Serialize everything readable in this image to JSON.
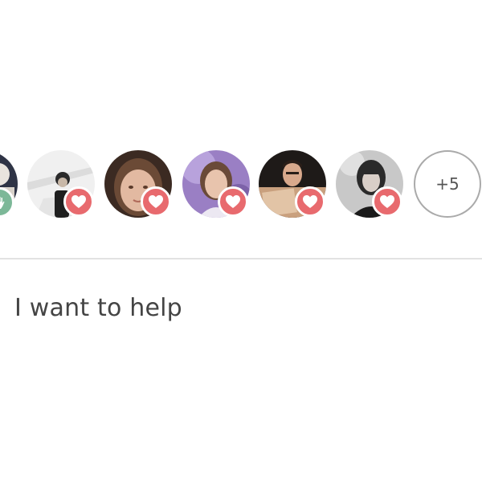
{
  "avatars": [
    {
      "name": "supporter-1",
      "reaction": "hand-icon"
    },
    {
      "name": "supporter-2",
      "reaction": "heart-icon"
    },
    {
      "name": "supporter-3",
      "reaction": "heart-icon"
    },
    {
      "name": "supporter-4",
      "reaction": "heart-icon"
    },
    {
      "name": "supporter-5",
      "reaction": "heart-icon"
    },
    {
      "name": "supporter-6",
      "reaction": "heart-icon"
    }
  ],
  "more_count": "+5",
  "help_option": {
    "label": "I want to help"
  },
  "colors": {
    "heart_badge": "#e86a6e",
    "hand_badge": "#7cb898",
    "divider": "#e2e2e2",
    "text": "#444444"
  }
}
